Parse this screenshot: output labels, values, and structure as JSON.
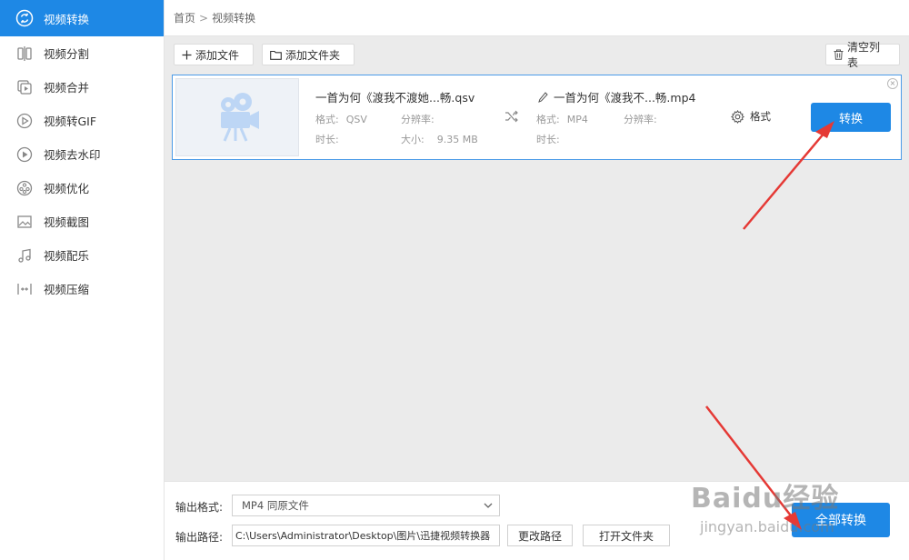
{
  "sidebar": {
    "items": [
      {
        "label": "视频转换",
        "icon": "convert-icon",
        "active": true
      },
      {
        "label": "视频分割",
        "icon": "split-icon"
      },
      {
        "label": "视频合并",
        "icon": "merge-icon"
      },
      {
        "label": "视频转GIF",
        "icon": "gif-icon"
      },
      {
        "label": "视频去水印",
        "icon": "remove-watermark-icon"
      },
      {
        "label": "视频优化",
        "icon": "optimize-icon"
      },
      {
        "label": "视频截图",
        "icon": "screenshot-icon"
      },
      {
        "label": "视频配乐",
        "icon": "music-icon"
      },
      {
        "label": "视频压缩",
        "icon": "compress-icon"
      }
    ]
  },
  "breadcrumb": {
    "home": "首页",
    "sep": ">",
    "current": "视频转换"
  },
  "toolbar": {
    "add_file": "添加文件",
    "add_folder": "添加文件夹",
    "clear_list": "清空列表"
  },
  "file": {
    "source": {
      "name": "一首为何《渡我不渡她...畅.qsv",
      "format_label": "格式:",
      "format": "QSV",
      "resolution_label": "分辨率:",
      "resolution": "",
      "duration_label": "时长:",
      "duration": "",
      "size_label": "大小:",
      "size": "9.35 MB"
    },
    "target": {
      "name": "一首为何《渡我不...畅.mp4",
      "format_label": "格式:",
      "format": "MP4",
      "resolution_label": "分辨率:",
      "resolution": "",
      "duration_label": "时长:",
      "duration": ""
    },
    "format_button": "格式",
    "convert_button": "转换",
    "close": "×"
  },
  "bottom": {
    "format_label": "输出格式:",
    "format_value": "MP4  同原文件",
    "path_label": "输出路径:",
    "path_value": "C:\\Users\\Administrator\\Desktop\\图片\\迅捷视频转换器",
    "change_path": "更改路径",
    "open_folder": "打开文件夹",
    "convert_all": "全部转换"
  },
  "watermark": {
    "brand": "Baidu经验",
    "sub": "jingyan.baidu.com"
  },
  "colors": {
    "accent": "#1e88e5",
    "arrow": "#e53935"
  }
}
